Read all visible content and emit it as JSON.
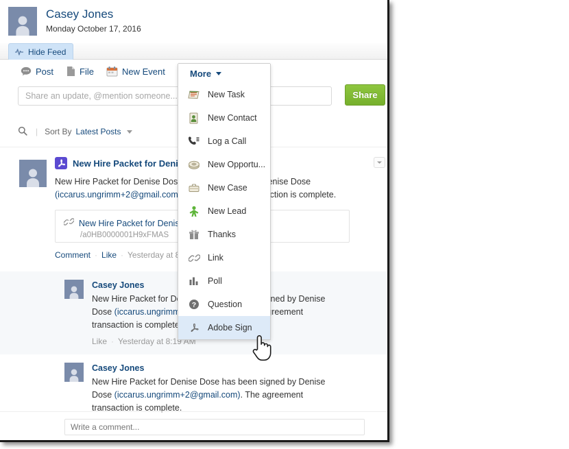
{
  "header": {
    "user_name": "Casey Jones",
    "date": "Monday October 17, 2016",
    "avatar_icon": "user-silhouette-icon"
  },
  "feed_tab": {
    "label": "Hide Feed",
    "icon": "pulse-icon"
  },
  "publisher": {
    "tabs": [
      {
        "label": "Post",
        "icon": "speech-bubble-icon"
      },
      {
        "label": "File",
        "icon": "file-icon"
      },
      {
        "label": "New Event",
        "icon": "calendar-icon"
      }
    ],
    "more_label": "More",
    "share_placeholder": "Share an update, @mention someone...",
    "share_button": "Share"
  },
  "more_menu": {
    "items": [
      {
        "label": "New Task",
        "icon": "task-icon",
        "selected": false
      },
      {
        "label": "New Contact",
        "icon": "contact-card-icon",
        "selected": false
      },
      {
        "label": "Log a Call",
        "icon": "phone-icon",
        "selected": false
      },
      {
        "label": "New Opportu...",
        "icon": "opportunity-icon",
        "selected": false
      },
      {
        "label": "New Case",
        "icon": "briefcase-icon",
        "selected": false
      },
      {
        "label": "New Lead",
        "icon": "lead-person-icon",
        "selected": false
      },
      {
        "label": "Thanks",
        "icon": "gift-icon",
        "selected": false
      },
      {
        "label": "Link",
        "icon": "link-chain-icon",
        "selected": false
      },
      {
        "label": "Poll",
        "icon": "bar-chart-icon",
        "selected": false
      },
      {
        "label": "Question",
        "icon": "question-mark-icon",
        "selected": false
      },
      {
        "label": "Adobe Sign",
        "icon": "adobe-sign-icon",
        "selected": true
      }
    ]
  },
  "sort": {
    "search_icon": "magnifier-icon",
    "label": "Sort By",
    "value": "Latest Posts"
  },
  "post": {
    "title": "New Hire Packet for Denise Dose",
    "title_icon": "pdf-icon",
    "body_line1": "New Hire Packet for Denise Dose has been signed by Denise Dose",
    "body_line2_link": "(iccarus.ungrimm+2@gmail.com)",
    "body_line2_rest": ". The agreement transaction is complete.",
    "attachment": {
      "icon": "link-chain-icon",
      "title": "New Hire Packet for Denise Dose",
      "url": "/a0HB0000001H9xFMAS"
    },
    "actions": {
      "comment": "Comment",
      "like": "Like",
      "time": "Yesterday at 8:19 AM"
    },
    "menu_icon": "chevron-down-icon"
  },
  "comments": [
    {
      "author": "Casey Jones",
      "text_a": "New Hire Packet for Denise Dose has been signed by Denise Dose",
      "text_b": "(iccarus.ungrimm+2@gmail.com)",
      "text_c": ". The agreement transaction is complete.",
      "like": "Like",
      "time": "Yesterday at 8:19 AM"
    },
    {
      "author": "Casey Jones",
      "text_a": "New Hire Packet for Denise Dose has been signed by Denise Dose",
      "text_b": "(iccarus.ungrimm+2@gmail.com)",
      "text_c": ". The agreement transaction is complete.",
      "like": "Like",
      "time": "Yesterday at 8:19 AM"
    }
  ],
  "write_comment": {
    "placeholder": "Write a comment..."
  },
  "colors": {
    "link_blue": "#15497b",
    "share_green": "#76b02c",
    "selection_blue": "#ddeaf8",
    "avatar_gray": "#7a8baa",
    "pdf_purple": "#5b4ad1"
  }
}
